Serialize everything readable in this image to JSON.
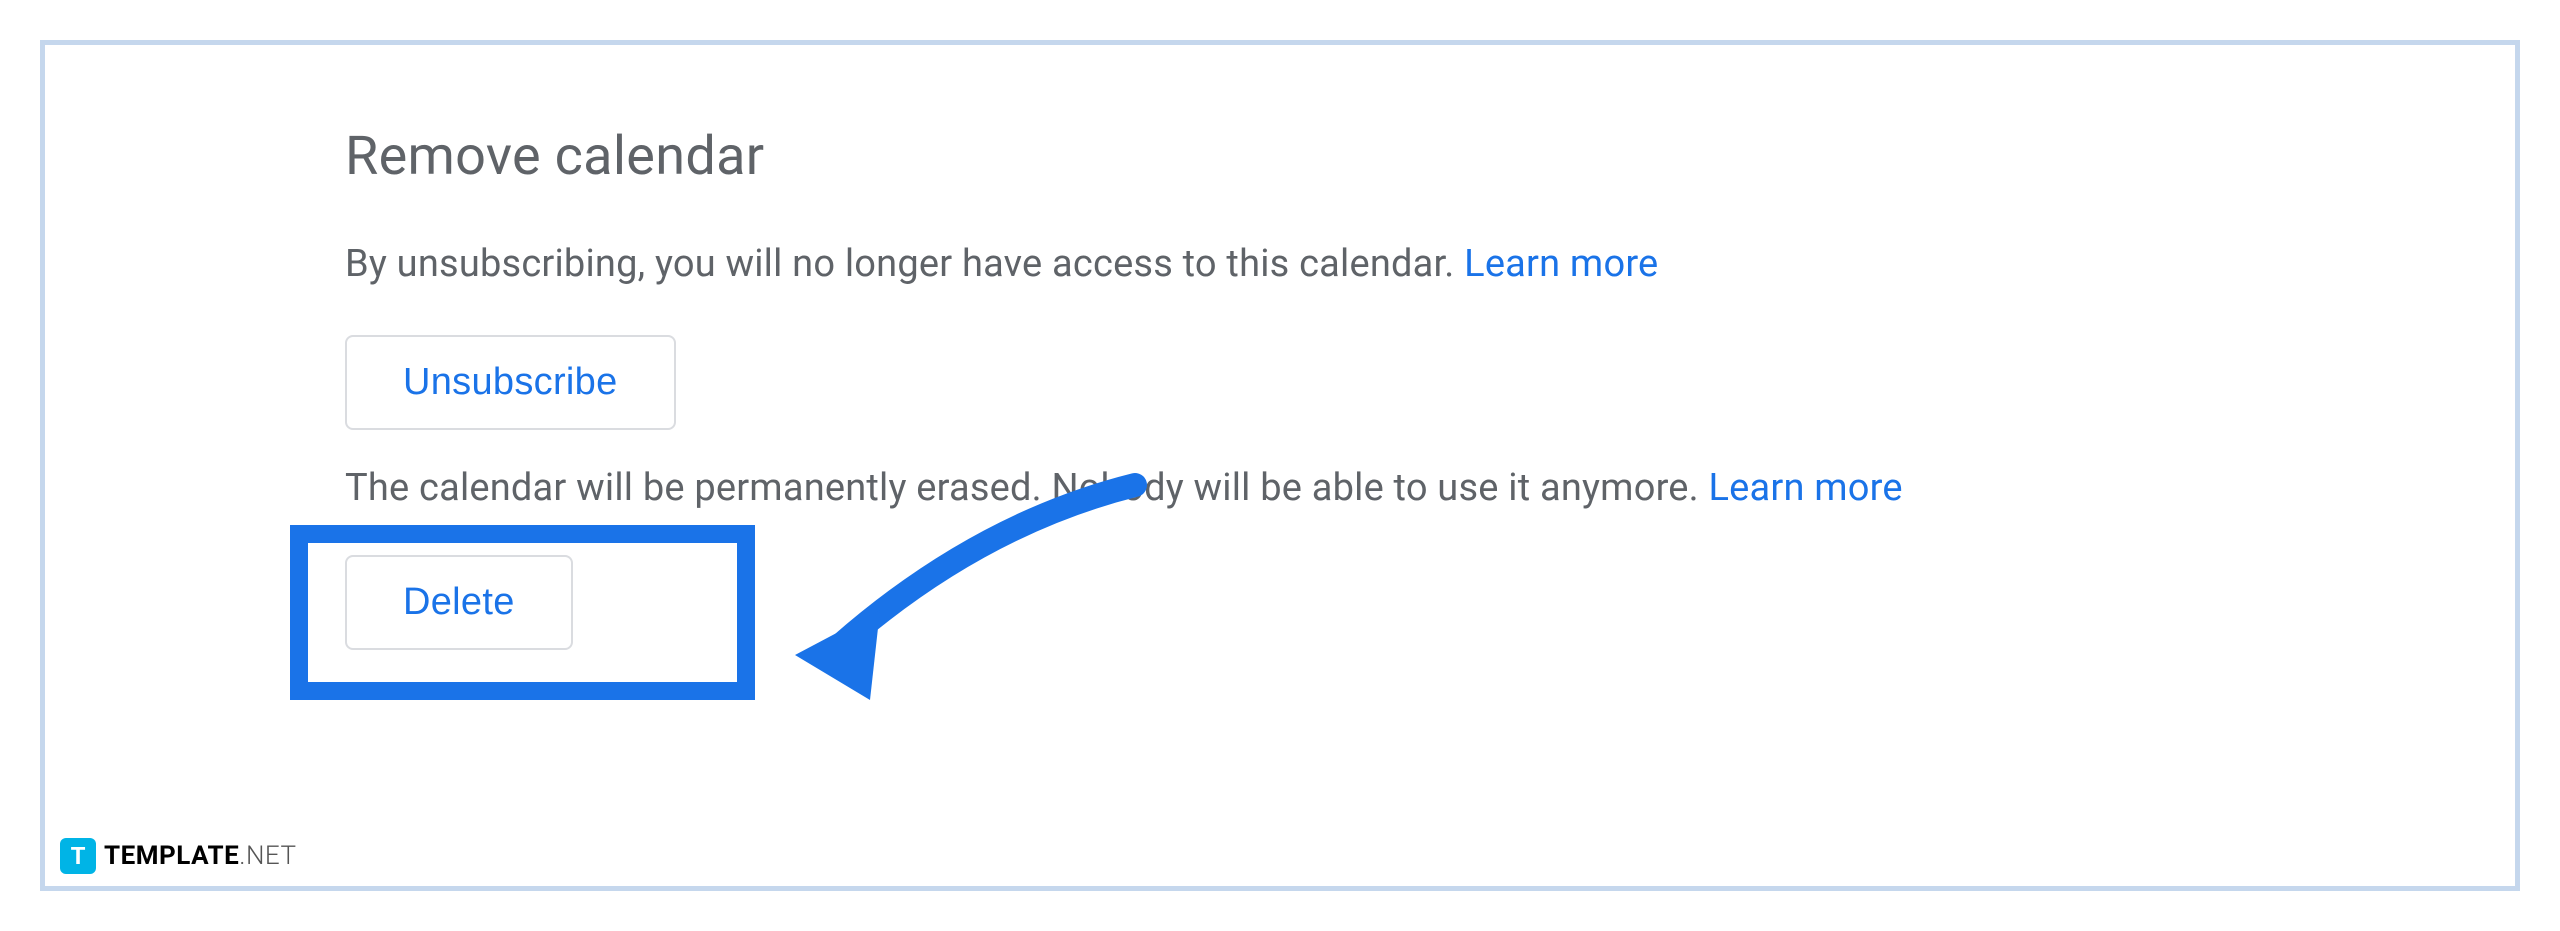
{
  "section": {
    "title": "Remove calendar",
    "unsubscribe_description": "By unsubscribing, you will no longer have access to this calendar. ",
    "learn_more_1": "Learn more",
    "unsubscribe_button": "Unsubscribe",
    "delete_description": "The calendar will be permanently erased. Nobody will be able to use it anymore. ",
    "learn_more_2": "Learn more",
    "delete_button": "Delete"
  },
  "watermark": {
    "icon_letter": "T",
    "text_bold": "TEMPLATE",
    "text_light": ".NET"
  }
}
